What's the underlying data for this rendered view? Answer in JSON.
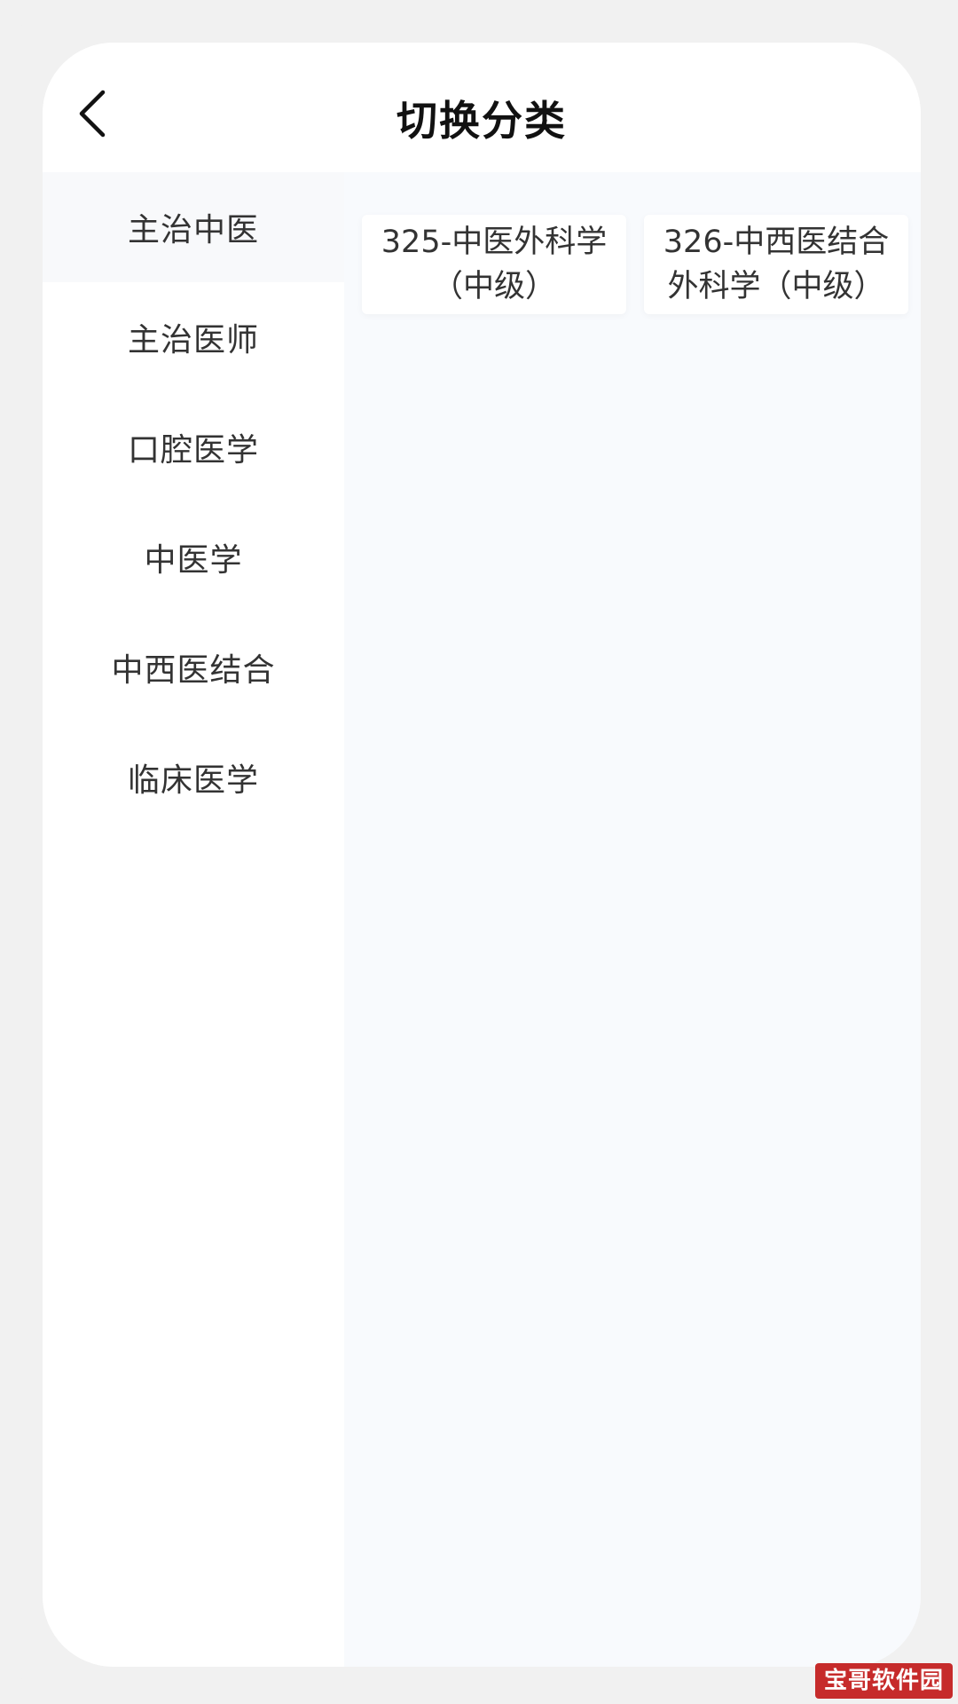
{
  "header": {
    "title": "切换分类",
    "back_icon": "chevron-left-icon"
  },
  "sidebar": {
    "active_index": 0,
    "items": [
      {
        "label": "主治中医"
      },
      {
        "label": "主治医师"
      },
      {
        "label": "口腔医学"
      },
      {
        "label": "中医学"
      },
      {
        "label": "中西医结合"
      },
      {
        "label": "临床医学"
      }
    ]
  },
  "content": {
    "subjects": [
      {
        "label": "325-中医外科学（中级）"
      },
      {
        "label": "326-中西医结合外科学（中级）"
      }
    ]
  },
  "watermark": {
    "text": "宝哥软件园"
  },
  "colors": {
    "frame": "#f1f1f1",
    "screen": "#ffffff",
    "content_bg": "#f8fafd",
    "active_item_bg": "#f8f9fb",
    "text": "#333333",
    "title": "#111111",
    "watermark_bg": "#c62b2b"
  }
}
